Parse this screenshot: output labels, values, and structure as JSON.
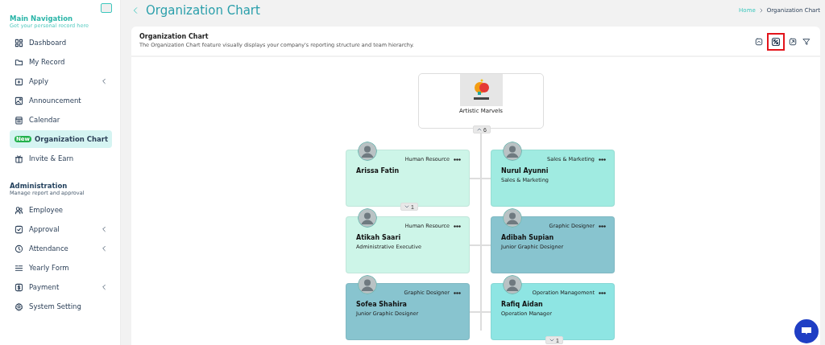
{
  "sidebar": {
    "sections": [
      {
        "title": "Main Navigation",
        "subtitle": "Get your personal record here",
        "items": [
          {
            "label": "Dashboard",
            "expandable": false,
            "selected": false
          },
          {
            "label": "My Record",
            "expandable": false,
            "selected": false
          },
          {
            "label": "Apply",
            "expandable": true,
            "selected": false
          },
          {
            "label": "Announcement",
            "expandable": false,
            "selected": false
          },
          {
            "label": "Calendar",
            "expandable": false,
            "selected": false
          },
          {
            "label": "Organization Chart",
            "badge": "New",
            "expandable": false,
            "selected": true
          },
          {
            "label": "Invite & Earn",
            "expandable": false,
            "selected": false
          }
        ]
      },
      {
        "title": "Administration",
        "subtitle": "Manage report and approval",
        "items": [
          {
            "label": "Employee",
            "expandable": false,
            "selected": false
          },
          {
            "label": "Approval",
            "expandable": true,
            "selected": false
          },
          {
            "label": "Attendance",
            "expandable": true,
            "selected": false
          },
          {
            "label": "Yearly Form",
            "expandable": false,
            "selected": false
          },
          {
            "label": "Payment",
            "expandable": true,
            "selected": false
          },
          {
            "label": "System Setting",
            "expandable": false,
            "selected": false
          }
        ]
      }
    ]
  },
  "header": {
    "title": "Organization Chart",
    "breadcrumb": [
      {
        "label": "Home",
        "link": true
      },
      {
        "label": "Organization Chart",
        "link": false
      }
    ]
  },
  "card": {
    "title": "Organization Chart",
    "description": "The Organization Chart feature visually displays your company's reporting structure and team hierarchy.",
    "toolbar": [
      {
        "kind": "collapse",
        "highlighted": false
      },
      {
        "kind": "fit",
        "highlighted": true
      },
      {
        "kind": "expand",
        "highlighted": false
      },
      {
        "kind": "filter",
        "highlighted": false
      }
    ]
  },
  "org_chart": {
    "root": {
      "name": "Artistic Marvels",
      "toggle": "6"
    },
    "members": [
      {
        "name": "Arissa Fatin",
        "department": "Human Resource",
        "color": "#cdf5e8",
        "toggle": "1"
      },
      {
        "name": "Nurul Ayunni",
        "department": "Sales & Marketing",
        "position": "Sales & Marketing",
        "color": "#a0ebe1"
      },
      {
        "name": "Atikah Saari",
        "department": "Human Resource",
        "position": "Administrative Executive",
        "color": "#cdf5e8"
      },
      {
        "name": "Adibah Supian",
        "department": "Graphic Designer",
        "position": "Junior Graphic Designer",
        "color": "#88c4cf"
      },
      {
        "name": "Sofea Shahira",
        "department": "Graphic Designer",
        "position": "Junior Graphic Designer",
        "color": "#88c4cf"
      },
      {
        "name": "Rafiq Aidan",
        "department": "Operation Management",
        "position": "Operation Manager",
        "color": "#8ee5e3",
        "toggle": "1"
      }
    ]
  }
}
